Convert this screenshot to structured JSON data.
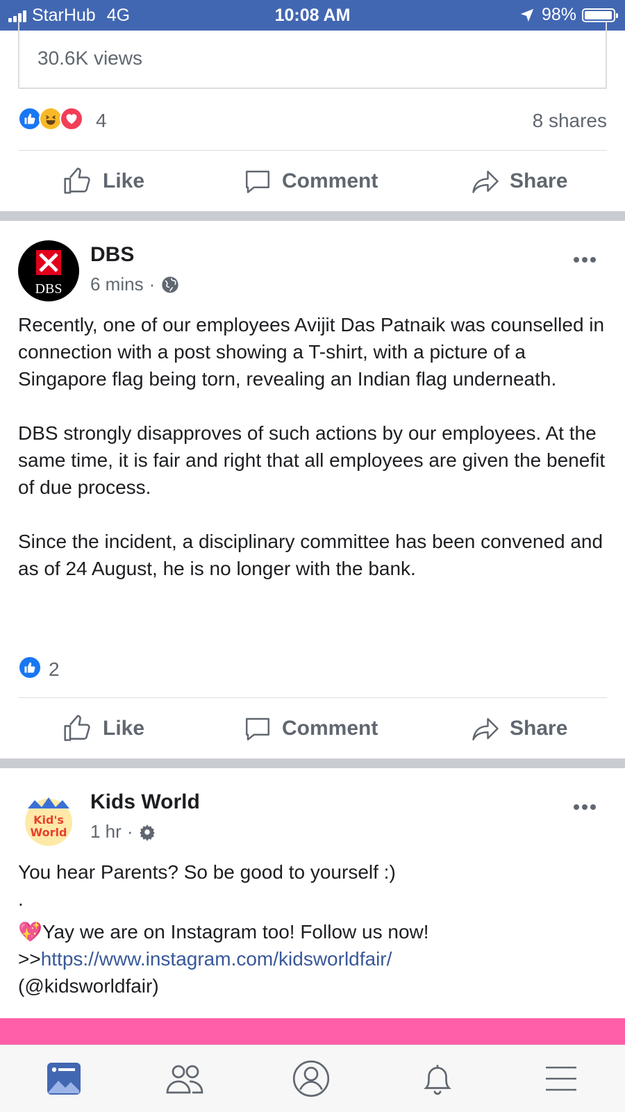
{
  "status_bar": {
    "carrier": "StarHub",
    "network": "4G",
    "time": "10:08 AM",
    "battery": "98%",
    "battery_level": 0.98
  },
  "prev_post": {
    "views": "30.6K views",
    "reactions": [
      "like",
      "haha",
      "love"
    ],
    "reaction_count": "4",
    "shares": "8 shares"
  },
  "actions": {
    "like": "Like",
    "comment": "Comment",
    "share": "Share"
  },
  "dbs_post": {
    "page_name": "DBS",
    "avatar_text": "DBS",
    "time": "6 mins",
    "audience_icon": "globe-icon",
    "paragraphs": [
      "Recently, one of our employees Avijit Das Patnaik was counselled in connection with a post showing a T-shirt, with a picture of a Singapore flag being torn, revealing an Indian flag underneath.",
      "DBS strongly disapproves of such actions by our employees. At the same time, it is fair and right that all employees are given the benefit of due process.",
      "Since the incident, a disciplinary committee has been convened and as of 24 August, he is no longer with the bank."
    ],
    "reactions": [
      "like"
    ],
    "reaction_count": "2"
  },
  "kids_post": {
    "page_name": "Kids World",
    "avatar_text": "Kids World",
    "time": "1 hr",
    "audience_icon": "gear-icon",
    "line1": "You hear Parents? So be good to yourself :)",
    "line2": ".",
    "line3_emoji": "💖",
    "line3": "Yay we are on Instagram too! Follow us now!",
    "link_prefix": ">>",
    "link": "https://www.instagram.com/kidsworldfair/",
    "handle": "(@kidsworldfair)"
  },
  "bottom_nav": [
    "news-feed-icon",
    "friends-icon",
    "profile-icon",
    "notifications-icon",
    "menu-icon"
  ],
  "colors": {
    "brand_blue": "#4267b2",
    "link": "#385898",
    "like_blue": "#1877f2",
    "strip_pink": "#ff5fa8"
  }
}
